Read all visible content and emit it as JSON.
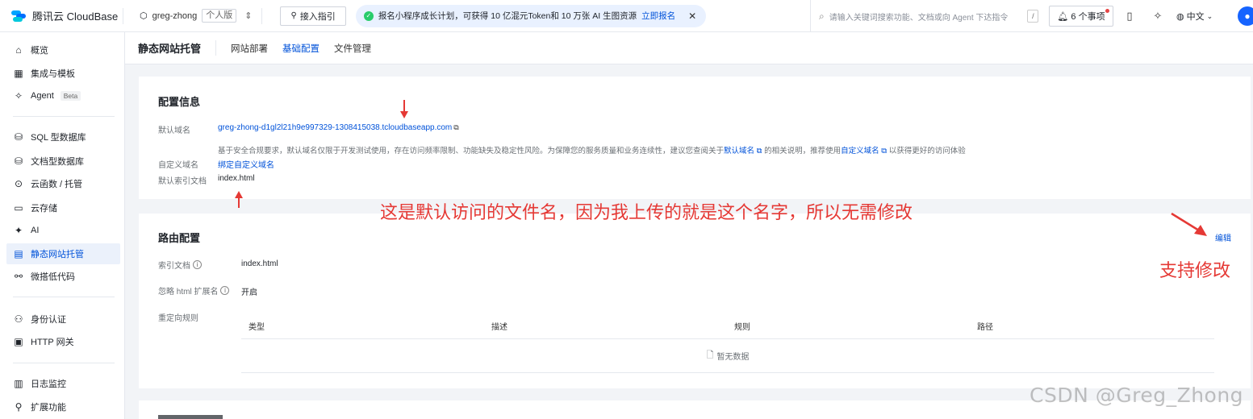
{
  "topbar": {
    "brand_name": "腾讯云 CloudBase",
    "env_name": "greg-zhong",
    "env_tag": "个人版",
    "guide_label": "接入指引",
    "promo_text": "报名小程序成长计划，可获得 10 亿混元Token和 10 万张 AI 生图资源",
    "promo_link": "立即报名",
    "search_placeholder": "请输入关键词搜索功能、文档或向 Agent 下达指令",
    "search_key": "/",
    "todo_label": "6 个事项",
    "lang_label": "中文"
  },
  "sidebar": {
    "items": [
      {
        "label": "概览",
        "icon": "home-icon"
      },
      {
        "label": "集成与模板",
        "icon": "grid-icon"
      },
      {
        "label": "Agent",
        "icon": "sparkle-icon",
        "badge": "Beta"
      },
      {
        "label": "SQL 型数据库",
        "icon": "database-icon"
      },
      {
        "label": "文档型数据库",
        "icon": "document-db-icon"
      },
      {
        "label": "云函数 / 托管",
        "icon": "function-icon"
      },
      {
        "label": "云存储",
        "icon": "storage-icon"
      },
      {
        "label": "AI",
        "icon": "ai-icon"
      },
      {
        "label": "静态网站托管",
        "icon": "hosting-icon"
      },
      {
        "label": "微搭低代码",
        "icon": "lowcode-icon"
      },
      {
        "label": "身份认证",
        "icon": "user-icon"
      },
      {
        "label": "HTTP 网关",
        "icon": "gateway-icon"
      },
      {
        "label": "日志监控",
        "icon": "log-icon"
      },
      {
        "label": "扩展功能",
        "icon": "extension-icon"
      }
    ],
    "active_index": 8
  },
  "content": {
    "page_title": "静态网站托管",
    "tabs": [
      "网站部署",
      "基础配置",
      "文件管理"
    ],
    "active_tab": 1
  },
  "config": {
    "title": "配置信息",
    "default_domain_label": "默认域名",
    "default_domain_value": "greg-zhong-d1gl2l21h9e997329-1308415038.tcloudbaseapp.com",
    "note_prefix": "基于安全合规要求，默认域名仅限于开发测试使用，存在访问频率限制、功能缺失及稳定性风险。为保障您的服务质量和业务连续性，建议您查阅关于",
    "note_link1": "默认域名",
    "note_middle": "的相关说明，推荐使用",
    "note_link2": "自定义域名",
    "note_suffix": "以获得更好的访问体验",
    "custom_domain_label": "自定义域名",
    "custom_domain_link": "绑定自定义域名",
    "index_doc_label": "默认索引文档",
    "index_doc_value": "index.html"
  },
  "routing": {
    "title": "路由配置",
    "edit_label": "编辑",
    "index_label": "索引文档",
    "index_value": "index.html",
    "ignore_html_label": "忽略 html 扩展名",
    "ignore_html_value": "开启",
    "redirect_label": "重定向规则",
    "columns": [
      "类型",
      "描述",
      "规则",
      "路径"
    ],
    "empty_text": "暂无数据"
  },
  "annotations": {
    "main": "这是默认访问的文件名，因为我上传的就是这个名字，所以无需修改",
    "edit": "支持修改",
    "color": "#e53935"
  },
  "watermark": "CSDN @Greg_Zhong"
}
